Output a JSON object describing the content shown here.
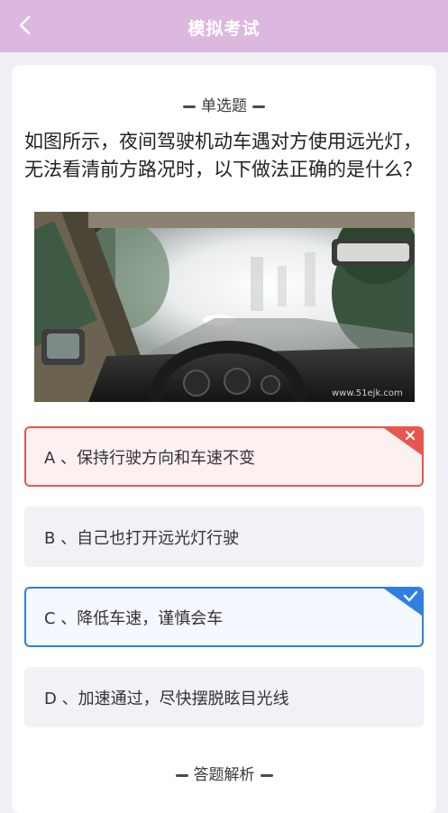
{
  "header": {
    "title": "模拟考试",
    "back_icon": "back-arrow-icon"
  },
  "question": {
    "type_label": "单选题",
    "text": "如图所示，夜间驾驶机动车遇对方使用远光灯，无法看清前方路况时，以下做法正确的是什么？",
    "image_watermark": "www.51ejk.com"
  },
  "options": [
    {
      "text": "A 、保持行驶方向和车速不变",
      "state": "wrong"
    },
    {
      "text": "B 、自己也打开远光灯行驶",
      "state": "normal"
    },
    {
      "text": "C 、降低车速，谨慎会车",
      "state": "correct"
    },
    {
      "text": "D 、加速通过，尽快摆脱眩目光线",
      "state": "normal"
    }
  ],
  "analysis": {
    "label": "答题解析"
  },
  "colors": {
    "header_bg": "#dcb8de",
    "wrong": "#e8574f",
    "correct": "#2f7fe0",
    "option_bg": "#f1f2f6"
  }
}
